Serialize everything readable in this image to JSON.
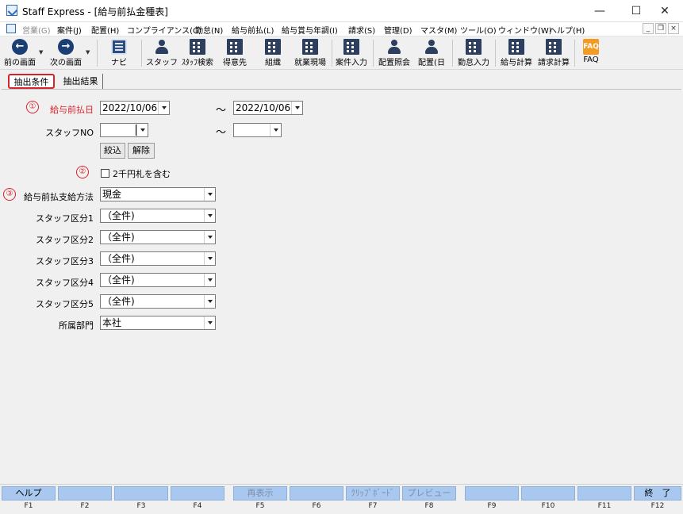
{
  "window": {
    "title": "Staff Express - [給与前払金種表]",
    "minimize": "—",
    "maximize": "☐",
    "close": "✕"
  },
  "menu": {
    "items": [
      {
        "label": "営業(G)",
        "disabled": true
      },
      {
        "label": "案件(J)",
        "disabled": false
      },
      {
        "label": "配置(H)",
        "disabled": false
      },
      {
        "label": "コンプライアンス(C)",
        "disabled": false
      },
      {
        "label": "勤怠(N)",
        "disabled": false
      },
      {
        "label": "給与前払(L)",
        "disabled": false
      },
      {
        "label": "給与賞与年調(I)",
        "disabled": false
      },
      {
        "label": "請求(S)",
        "disabled": false
      },
      {
        "label": "管理(D)",
        "disabled": false
      },
      {
        "label": "マスタ(M)",
        "disabled": false
      },
      {
        "label": "ツール(O)",
        "disabled": false
      },
      {
        "label": "ウィンドウ(W)",
        "disabled": false
      },
      {
        "label": "ヘルプ(H)",
        "disabled": false
      }
    ],
    "mdi_min": "_",
    "mdi_restore": "❐",
    "mdi_close": "×"
  },
  "toolbar": {
    "items": [
      {
        "label": "前の画面",
        "icon": "arrow-left-icon",
        "glyph": "←"
      },
      {
        "label": "次の画面",
        "icon": "arrow-right-icon",
        "glyph": "→"
      },
      {
        "label": "ナビ",
        "icon": "navi-icon",
        "glyph": ""
      },
      {
        "label": "スタッフ",
        "icon": "staff-icon",
        "glyph": ""
      },
      {
        "label": "ｽﾀｯﾌ検索",
        "icon": "staff-search-icon",
        "glyph": ""
      },
      {
        "label": "得意先",
        "icon": "client-icon",
        "glyph": ""
      },
      {
        "label": "組織",
        "icon": "organization-icon",
        "glyph": ""
      },
      {
        "label": "就業現場",
        "icon": "worksite-icon",
        "glyph": ""
      },
      {
        "label": "案件入力",
        "icon": "case-entry-icon",
        "glyph": ""
      },
      {
        "label": "配置照会",
        "icon": "placement-inquiry-icon",
        "glyph": ""
      },
      {
        "label": "配置(日",
        "icon": "placement-daily-icon",
        "glyph": ""
      },
      {
        "label": "勤怠入力",
        "icon": "attendance-entry-icon",
        "glyph": ""
      },
      {
        "label": "給与計算",
        "icon": "payroll-calc-icon",
        "glyph": ""
      },
      {
        "label": "請求計算",
        "icon": "billing-calc-icon",
        "glyph": ""
      },
      {
        "label": "FAQ",
        "icon": "faq-icon",
        "glyph": "FAQ"
      }
    ]
  },
  "tabs": [
    {
      "label": "抽出条件",
      "active": true
    },
    {
      "label": "抽出結果",
      "active": false
    }
  ],
  "form": {
    "markers": [
      "①",
      "②",
      "③"
    ],
    "pay_date_label": "給与前払日",
    "pay_date_from": "2022/10/06",
    "pay_date_to": "2022/10/06",
    "range_sep": "～",
    "staff_no_label": "スタッフNO",
    "staff_no_from": "",
    "staff_no_to": "",
    "narrow_button": "絞込",
    "clear_button": "解除",
    "include_2000_label": "2千円札を含む",
    "include_2000_checked": false,
    "method_label": "給与前払支給方法",
    "method_value": "現金",
    "staff_class_labels": [
      "スタッフ区分1",
      "スタッフ区分2",
      "スタッフ区分3",
      "スタッフ区分4",
      "スタッフ区分5"
    ],
    "staff_class_values": [
      "（全件)",
      "（全件)",
      "（全件)",
      "（全件)",
      "（全件)"
    ],
    "dept_label": "所属部門",
    "dept_value": "本社"
  },
  "fkeys": [
    {
      "key": "F1",
      "label": "ヘルプ",
      "disabled": false
    },
    {
      "key": "F2",
      "label": "",
      "disabled": false
    },
    {
      "key": "F3",
      "label": "",
      "disabled": false
    },
    {
      "key": "F4",
      "label": "",
      "disabled": false
    },
    {
      "key": "F5",
      "label": "再表示",
      "disabled": true
    },
    {
      "key": "F6",
      "label": "",
      "disabled": false
    },
    {
      "key": "F7",
      "label": "ｸﾘｯﾌﾟﾎﾞｰﾄﾞ",
      "disabled": true
    },
    {
      "key": "F8",
      "label": "プレビュー",
      "disabled": true
    },
    {
      "key": "F9",
      "label": "",
      "disabled": false
    },
    {
      "key": "F10",
      "label": "",
      "disabled": false
    },
    {
      "key": "F11",
      "label": "",
      "disabled": false
    },
    {
      "key": "F12",
      "label": "終　了",
      "disabled": false
    }
  ],
  "colors": {
    "accent_red": "#d9232a",
    "fkey_blue": "#a9c8ef",
    "icon_navy": "#1b3f75",
    "faq_orange": "#f39a22"
  }
}
